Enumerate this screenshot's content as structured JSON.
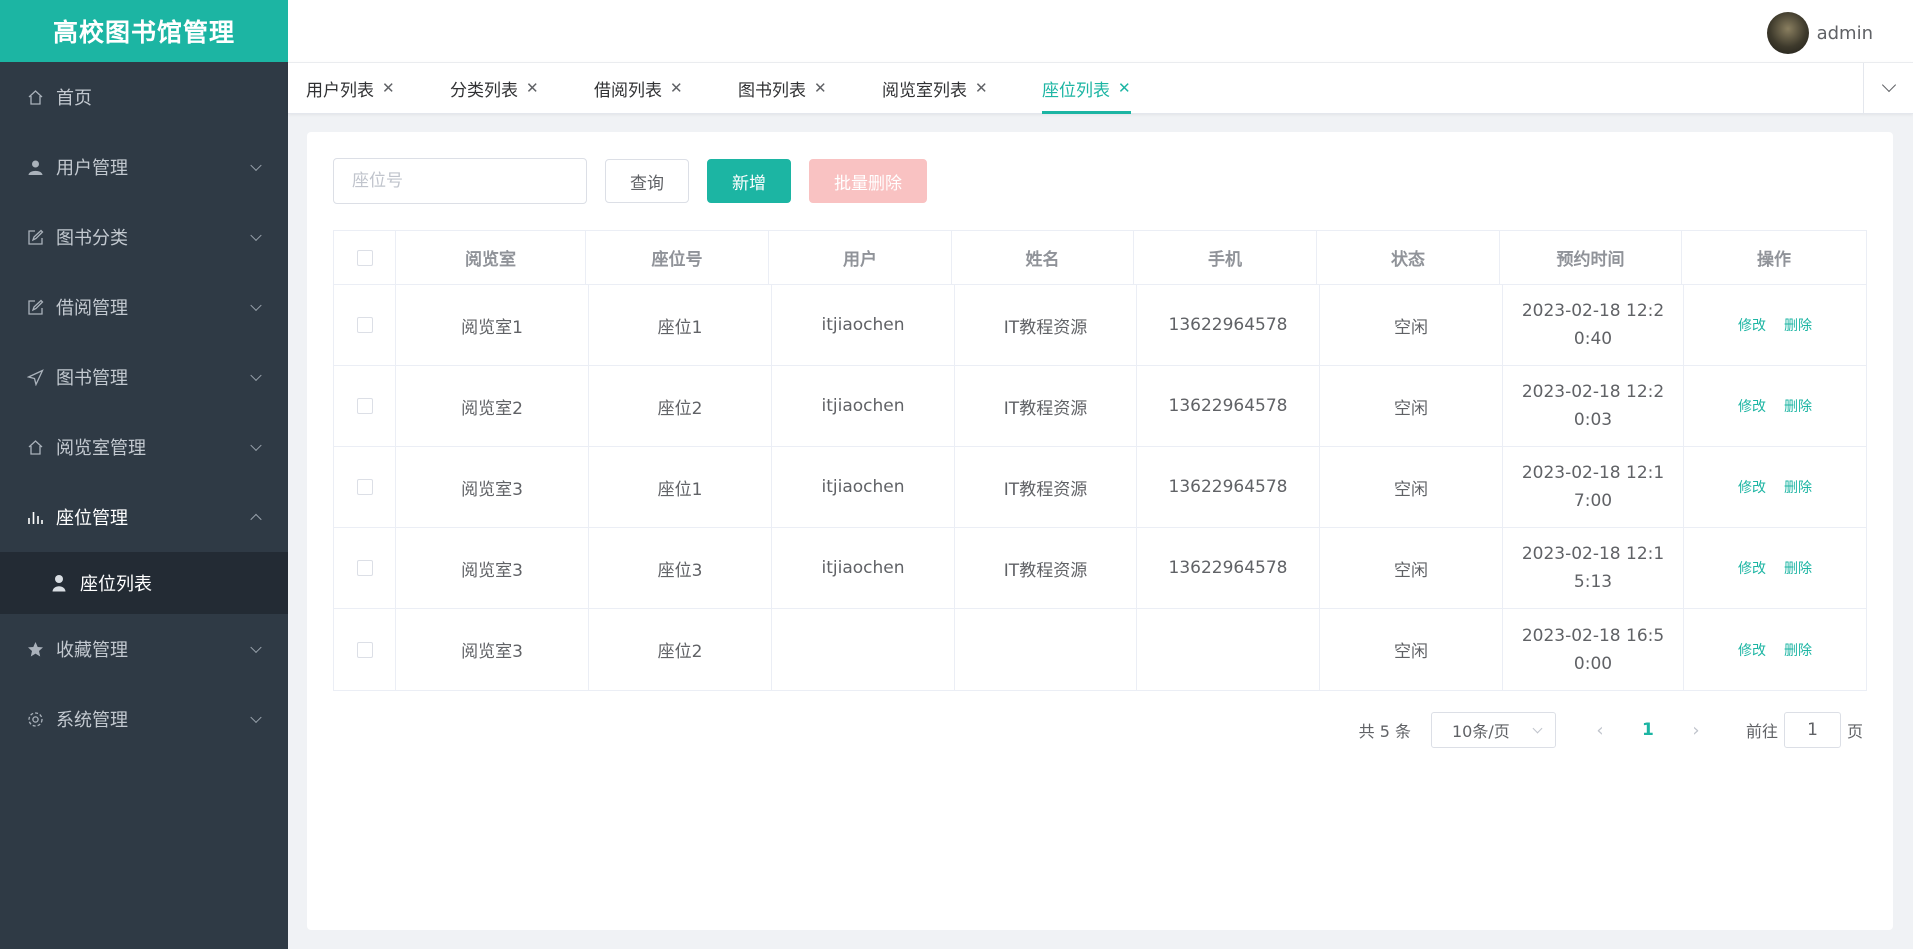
{
  "app": {
    "brand": "高校图书馆管理"
  },
  "header": {
    "username": "admin"
  },
  "sidebar": {
    "items": [
      {
        "label": "首页",
        "icon": "home-icon"
      },
      {
        "label": "用户管理",
        "icon": "user-icon"
      },
      {
        "label": "图书分类",
        "icon": "edit-icon"
      },
      {
        "label": "借阅管理",
        "icon": "edit-icon"
      },
      {
        "label": "图书管理",
        "icon": "send-icon"
      },
      {
        "label": "阅览室管理",
        "icon": "home-icon"
      },
      {
        "label": "座位管理",
        "icon": "bar-chart-icon"
      },
      {
        "label": "收藏管理",
        "icon": "star-icon"
      },
      {
        "label": "系统管理",
        "icon": "gear-icon"
      }
    ],
    "subitem": {
      "label": "座位列表",
      "icon": "person-icon"
    }
  },
  "tabs": [
    {
      "label": "用户列表"
    },
    {
      "label": "分类列表"
    },
    {
      "label": "借阅列表"
    },
    {
      "label": "图书列表"
    },
    {
      "label": "阅览室列表"
    },
    {
      "label": "座位列表"
    }
  ],
  "toolbar": {
    "search_placeholder": "座位号",
    "query_label": "查询",
    "add_label": "新增",
    "batch_delete_label": "批量删除"
  },
  "table": {
    "headers": [
      "阅览室",
      "座位号",
      "用户",
      "姓名",
      "手机",
      "状态",
      "预约时间",
      "操作"
    ],
    "rows": [
      {
        "room": "阅览室1",
        "seat": "座位1",
        "user": "itjiaochen",
        "name": "IT教程资源",
        "phone": "13622964578",
        "status": "空闲",
        "time": "2023-02-18 12:20:40"
      },
      {
        "room": "阅览室2",
        "seat": "座位2",
        "user": "itjiaochen",
        "name": "IT教程资源",
        "phone": "13622964578",
        "status": "空闲",
        "time": "2023-02-18 12:20:03"
      },
      {
        "room": "阅览室3",
        "seat": "座位1",
        "user": "itjiaochen",
        "name": "IT教程资源",
        "phone": "13622964578",
        "status": "空闲",
        "time": "2023-02-18 12:17:00"
      },
      {
        "room": "阅览室3",
        "seat": "座位3",
        "user": "itjiaochen",
        "name": "IT教程资源",
        "phone": "13622964578",
        "status": "空闲",
        "time": "2023-02-18 12:15:13"
      },
      {
        "room": "阅览室3",
        "seat": "座位2",
        "user": "",
        "name": "",
        "phone": "",
        "status": "空闲",
        "time": "2023-02-18 16:50:00"
      }
    ],
    "edit_label": "修改",
    "delete_label": "删除"
  },
  "pagination": {
    "total_text": "共 5 条",
    "page_size": "10条/页",
    "current_page": "1",
    "goto_prefix": "前往",
    "goto_value": "1",
    "goto_suffix": "页"
  },
  "colors": {
    "accent": "#1cb5a3",
    "sidebar_bg": "#2f3a45",
    "danger_light": "#f9c2c2"
  }
}
